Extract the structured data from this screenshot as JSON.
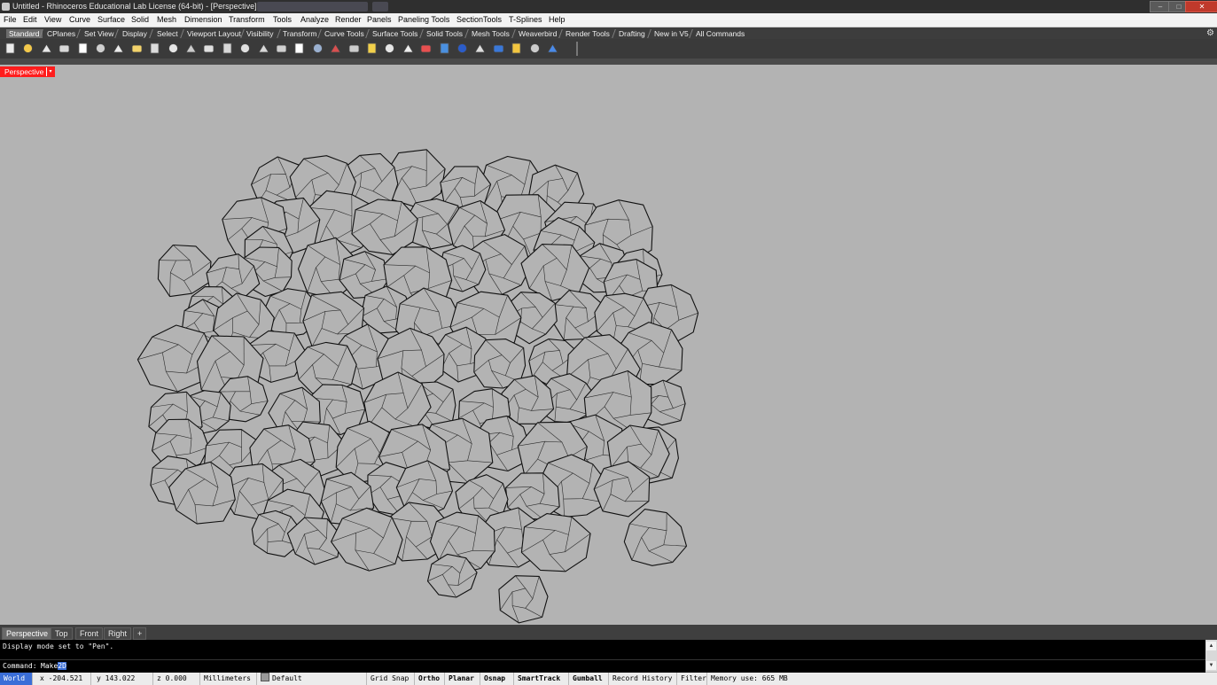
{
  "window": {
    "title": "Untitled - Rhinoceros Educational Lab License (64-bit) - [Perspective]",
    "controls": {
      "minimize": "–",
      "maximize": "□",
      "close": "✕"
    }
  },
  "menu": [
    "File",
    "Edit",
    "View",
    "Curve",
    "Surface",
    "Solid",
    "Mesh",
    "Dimension",
    "Transform",
    "Tools",
    "Analyze",
    "Render",
    "Panels",
    "Paneling Tools",
    "SectionTools",
    "T-Splines",
    "Help"
  ],
  "toolbar_tabs": [
    "Standard",
    "CPlanes",
    "Set View",
    "Display",
    "Select",
    "Viewport Layout",
    "Visibility",
    "Transform",
    "Curve Tools",
    "Surface Tools",
    "Solid Tools",
    "Mesh Tools",
    "Weaverbird",
    "Render Tools",
    "Drafting",
    "New in V5",
    "All Commands"
  ],
  "active_toolbar_tab": "Standard",
  "toolbar_icons": [
    "new-icon",
    "open-icon",
    "save-icon",
    "print-icon",
    "import-icon",
    "cut-icon",
    "copy-icon",
    "paste-icon",
    "undo-icon",
    "pan-icon",
    "rotate-view-icon",
    "zoom-icon",
    "zoom-window-icon",
    "zoom-extents-icon",
    "zoom-selected-icon",
    "zoom-previous-icon",
    "four-viewports-icon",
    "ghost-shade-icon",
    "rendered-icon",
    "wireframe-icon",
    "select-light-icon",
    "light-icon",
    "lock-icon",
    "material-icon",
    "color-wheel-icon",
    "sphere-icon",
    "render-icon",
    "environment-icon",
    "sun-icon",
    "named-views-icon",
    "help-icon"
  ],
  "viewport": {
    "label": "Perspective",
    "menu_arrow": "▾"
  },
  "viewport_tabs": [
    "Perspective",
    "Top",
    "Front",
    "Right",
    "+"
  ],
  "active_viewport_tab": "Perspective",
  "command_history": "Display mode set to \"Pen\".",
  "command": {
    "prompt": "Command:",
    "typed": "Make",
    "selected": "2D"
  },
  "status": {
    "cplane": "World",
    "x": "x -204.521",
    "y": "y 143.022",
    "z": "z 0.000",
    "units": "Millimeters",
    "layer": "Default",
    "toggles": [
      "Grid Snap",
      "Ortho",
      "Planar",
      "Osnap",
      "SmartTrack",
      "Gumball",
      "Record History",
      "Filter"
    ],
    "memory": "Memory use: 665 MB"
  },
  "colors": {
    "viewport_bg": "#b3b3b3",
    "viewport_label_bg": "#ff1d1d",
    "selection_blue": "#3a6ed8",
    "foam_line": "#111111"
  }
}
